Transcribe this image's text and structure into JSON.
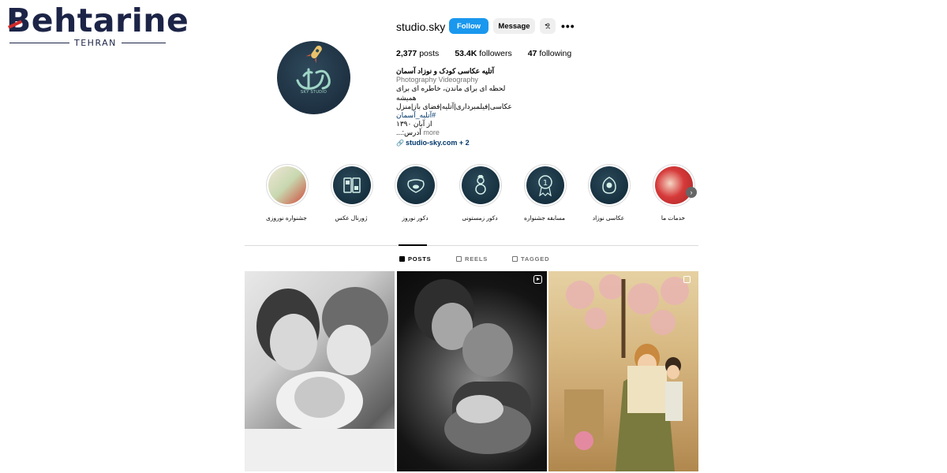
{
  "watermark": {
    "brand": "ehtarine",
    "brand_initial": "B",
    "city": "TEHRAN"
  },
  "profile": {
    "username": "studio.sky",
    "follow_label": "Follow",
    "message_label": "Message",
    "avatar_text": "SKY STUDIO",
    "stats": {
      "posts_count": "2,377",
      "posts_label": "posts",
      "followers_count": "53.4K",
      "followers_label": "followers",
      "following_count": "47",
      "following_label": "following"
    },
    "bio": {
      "name": "آتلیه عکاسی کودک و نوزاد آسمان",
      "category": "Photography Videography",
      "line1": "لحظه ای برای ماندن، خاطره ای برای همیشه",
      "line2": "عکاسی|فیلمبرداری|آتلیه|فضای باز|منزل",
      "hashtag": "#آتلیه_آسمان",
      "line3": "از آبان ۱۳۹۰",
      "line4": "آدرس:...",
      "more_label": "more",
      "link": "studio-sky.com + 2"
    }
  },
  "highlights": [
    {
      "label": "جشنواره نوروزی",
      "icon": "festival-icon"
    },
    {
      "label": "ژورنال عکس",
      "icon": "journal-icon"
    },
    {
      "label": "دکور نوروز",
      "icon": "goldfish-bowl-icon"
    },
    {
      "label": "دکور زمستونی",
      "icon": "snowman-icon"
    },
    {
      "label": "مسابقه جشنواره",
      "icon": "medal-icon"
    },
    {
      "label": "عکاسی نوزاد",
      "icon": "baby-icon"
    },
    {
      "label": "خدمات ما",
      "icon": "services-icon"
    }
  ],
  "tabs": [
    {
      "label": "POSTS",
      "active": true
    },
    {
      "label": "REELS",
      "active": false
    },
    {
      "label": "TAGGED",
      "active": false
    }
  ],
  "posts": [
    {
      "description_icon": "none"
    },
    {
      "description_icon": "reel-icon"
    },
    {
      "description_icon": "carousel-icon"
    }
  ],
  "colors": {
    "follow_button": "#1a98ee",
    "secondary_button": "#efefef",
    "link": "#00376b",
    "muted": "#737373"
  }
}
